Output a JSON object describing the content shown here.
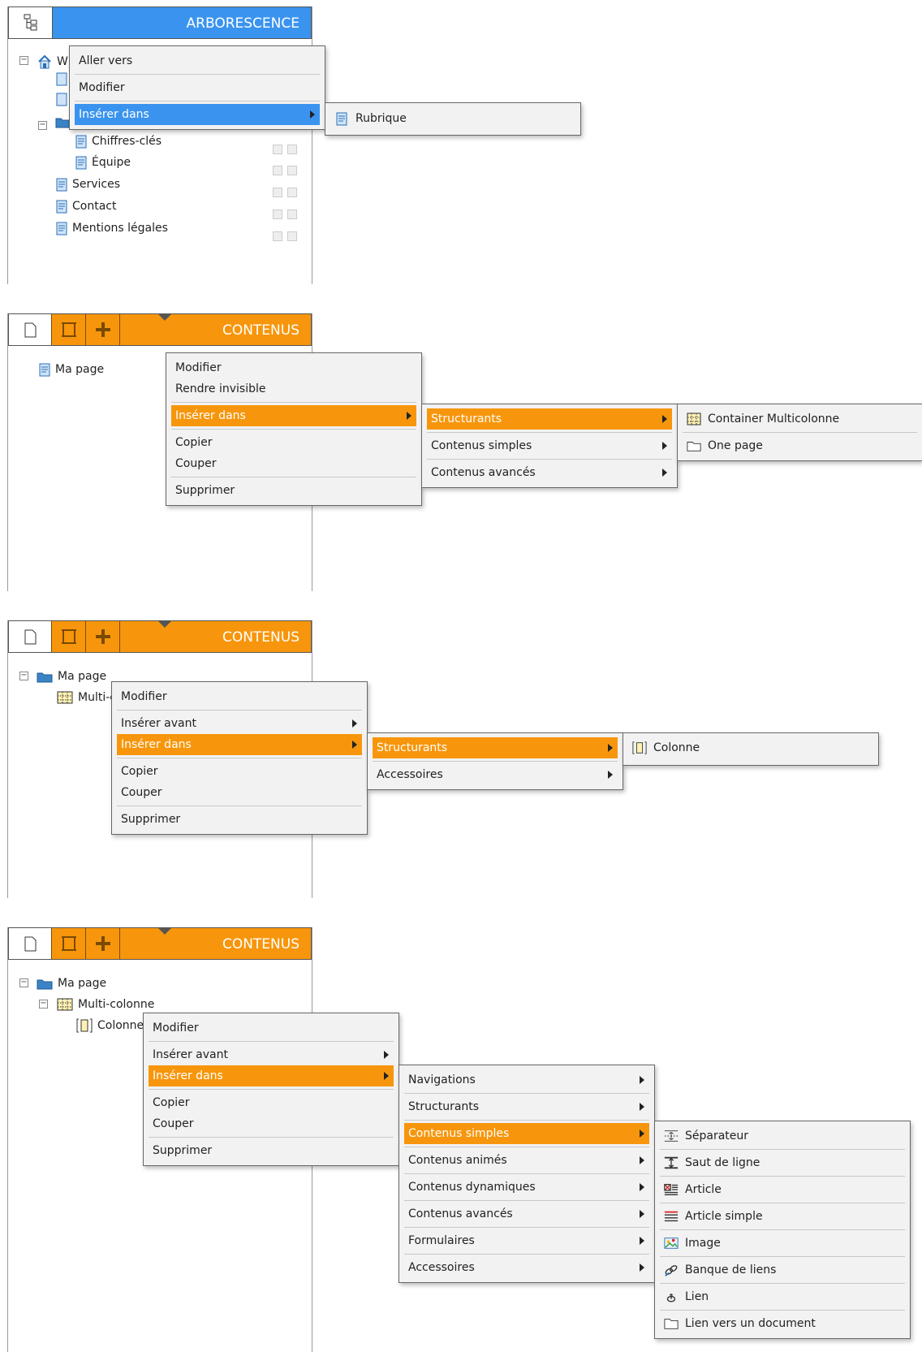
{
  "panel1": {
    "title": "ARBORESCENCE",
    "tree": {
      "root_label": "W",
      "items": [
        "Chiffres-clés",
        "Équipe",
        "Services",
        "Contact",
        "Mentions légales"
      ]
    },
    "menu": {
      "items": [
        "Aller vers",
        "Modifier",
        "Insérer dans"
      ]
    },
    "submenu": {
      "items": [
        "Rubrique"
      ]
    }
  },
  "panel2": {
    "title": "CONTENUS",
    "tree": {
      "items": [
        "Ma page"
      ]
    },
    "menu": {
      "items": [
        "Modifier",
        "Rendre invisible",
        "Insérer dans",
        "Copier",
        "Couper",
        "Supprimer"
      ]
    },
    "submenu": {
      "items": [
        "Structurants",
        "Contenus simples",
        "Contenus avancés"
      ]
    },
    "submenu2": {
      "items": [
        "Container Multicolonne",
        "One page"
      ]
    }
  },
  "panel3": {
    "title": "CONTENUS",
    "tree": {
      "items": [
        "Ma page",
        "Multi-c"
      ]
    },
    "menu": {
      "items": [
        "Modifier",
        "Insérer avant",
        "Insérer dans",
        "Copier",
        "Couper",
        "Supprimer"
      ]
    },
    "submenu": {
      "items": [
        "Structurants",
        "Accessoires"
      ]
    },
    "submenu2": {
      "items": [
        "Colonne"
      ]
    }
  },
  "panel4": {
    "title": "CONTENUS",
    "tree": {
      "items": [
        "Ma page",
        "Multi-colonne",
        "Colonne"
      ]
    },
    "menu": {
      "items": [
        "Modifier",
        "Insérer avant",
        "Insérer dans",
        "Copier",
        "Couper",
        "Supprimer"
      ]
    },
    "submenu": {
      "items": [
        "Navigations",
        "Structurants",
        "Contenus simples",
        "Contenus animés",
        "Contenus dynamiques",
        "Contenus avancés",
        "Formulaires",
        "Accessoires"
      ]
    },
    "submenu2": {
      "items": [
        "Séparateur",
        "Saut de ligne",
        "Article",
        "Article simple",
        "Image",
        "Banque de liens",
        "Lien",
        "Lien vers un document"
      ]
    }
  },
  "colors": {
    "blue_accent": "#3a94ef",
    "orange_accent": "#f7960c"
  },
  "icons": [
    "tree-icon",
    "page-icon",
    "frame-icon",
    "plus-icon",
    "folder-icon",
    "home-icon",
    "grid-icon",
    "column-icon"
  ]
}
